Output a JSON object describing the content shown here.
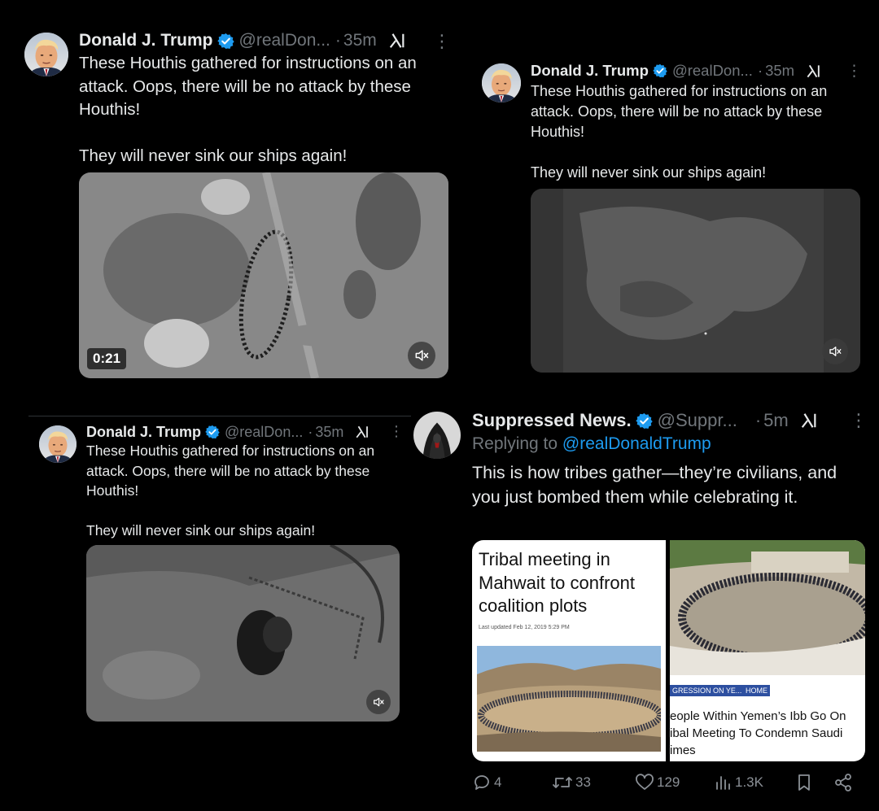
{
  "tweets": [
    {
      "author": "Donald J. Trump",
      "handle": "@realDon...",
      "sep": "·",
      "time": "35m",
      "more": "⋮",
      "text": "These Houthis gathered for instructions on an attack. Oops, there will be no attack by these Houthis!\n\nThey will never sink our ships again!",
      "video_duration": "0:21"
    },
    {
      "author": "Donald J. Trump",
      "handle": "@realDon...",
      "sep": "·",
      "time": "35m",
      "more": "⋮",
      "text": "These Houthis gathered for instructions on an attack. Oops, there will be no attack by these Houthis!\n\nThey will never sink our ships again!"
    },
    {
      "author": "Donald J. Trump",
      "handle": "@realDon...",
      "sep": "·",
      "time": "35m",
      "more": "⋮",
      "text": "These Houthis gathered for instructions on an attack. Oops, there will be no attack by these Houthis!\n\nThey will never sink our ships again!"
    },
    {
      "author": "Suppressed News.",
      "handle": "@Suppr...",
      "sep": "·",
      "time": "5m",
      "more": "⋮",
      "replying_prefix": "Replying to ",
      "replying_to": "@realDonaldTrump",
      "text": "This is how tribes gather—they’re civilians, and you just bombed them while celebrating it.",
      "cards": [
        {
          "title": "Tribal meeting in Mahwait to confront coalition plots",
          "date": "Last updated  Feb 12, 2019 5:29 PM"
        },
        {
          "tag1": "GRESSION ON YE...",
          "tag2": "HOME",
          "headline_lines": [
            "eople Within Yemen’s Ibb Go On",
            "ibal Meeting To Condemn Saudi",
            "imes"
          ]
        }
      ],
      "actions": {
        "replies": "4",
        "reposts": "33",
        "likes": "129",
        "views": "1.3K"
      }
    }
  ],
  "icons": {
    "verified": "verified-badge-icon",
    "grok": "grok-icon",
    "mute": "muted-speaker-icon",
    "reply": "reply-icon",
    "repost": "repost-icon",
    "like": "heart-icon",
    "views": "views-icon",
    "bookmark": "bookmark-icon",
    "share": "share-icon"
  },
  "colors": {
    "background": "#000000",
    "text": "#e7e9ea",
    "secondary": "#71767b",
    "link": "#1d9bf0",
    "verified": "#1d9bf0"
  }
}
